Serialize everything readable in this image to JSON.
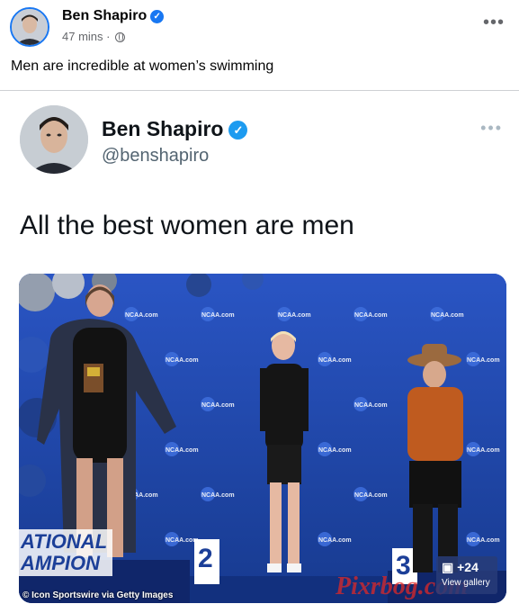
{
  "post": {
    "author": "Ben Shapiro",
    "time": "47 mins",
    "separator": "·",
    "text": "Men are incredible at women’s swimming",
    "more": "•••"
  },
  "tweet": {
    "name": "Ben Shapiro",
    "handle": "@benshapiro",
    "text": "All the best women are men",
    "more": "•••"
  },
  "photo": {
    "credit": "© Icon Sportswire via Getty Images",
    "gallery_count": "+24",
    "gallery_label": "View gallery",
    "watermark": "Pixrbog.com",
    "banner_line1": "ATIONAL",
    "banner_line2": "AMPION",
    "place_second": "2",
    "place_third": "3",
    "logo": "NCAA.com"
  },
  "colors": {
    "facebook_blue": "#1877f2",
    "twitter_blue": "#1d9bf0",
    "backdrop_blue": "#1c3f98"
  }
}
